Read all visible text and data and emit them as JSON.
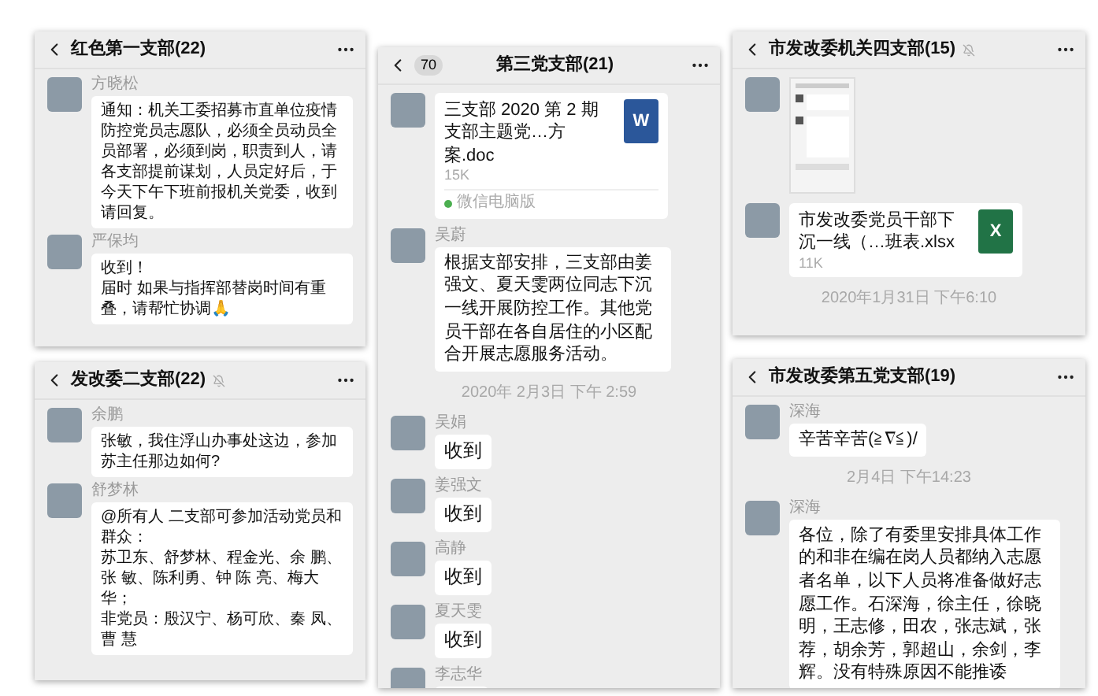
{
  "columns": [
    {
      "panels": [
        {
          "title": "红色第一支部(22)",
          "muted": false,
          "messages": [
            {
              "kind": "text",
              "sender": "方晓松",
              "text": "通知：机关工委招募市直单位疫情防控党员志愿队，必须全员动员全员部署，必须到岗，职责到人，请各支部提前谋划，人员定好后，于今天下午下班前报机关党委，收到请回复。"
            },
            {
              "kind": "text",
              "sender": "严保均",
              "lines": [
                "收到！",
                "届时 如果与指挥部替岗时间有重叠，请帮忙协调🙏"
              ]
            }
          ]
        },
        {
          "title": "发改委二支部(22)",
          "muted": true,
          "messages": [
            {
              "kind": "text",
              "sender": "余鹏",
              "text": "张敏，我住浮山办事处这边，参加苏主任那边如何?"
            },
            {
              "kind": "text",
              "sender": "舒梦林",
              "lines": [
                "@所有人 二支部可参加活动党员和群众：",
                "苏卫东、舒梦林、程金光、余 鹏、张 敏、陈利勇、钟 陈 亮、梅大华；",
                "非党员：殷汉宁、杨可欣、秦 凤、曹 慧"
              ]
            }
          ]
        }
      ]
    },
    {
      "panels": [
        {
          "title": "第三党支部(21)",
          "badge": "70",
          "muted": false,
          "messages": [
            {
              "kind": "file",
              "filename": "三支部 2020 第 2 期支部主题党…方案.doc",
              "size": "15K",
              "letter": "W",
              "color": "#2b579a",
              "source": "微信电脑版"
            },
            {
              "kind": "text",
              "sender": "吴蔚",
              "text": "根据支部安排，三支部由姜强文、夏天雯两位同志下沉一线开展防控工作。其他党员干部在各自居住的小区配合开展志愿服务活动。"
            },
            {
              "kind": "time",
              "text": "2020年 2月3日 下午 2:59"
            },
            {
              "kind": "text",
              "sender": "吴娟",
              "text": "收到"
            },
            {
              "kind": "text",
              "sender": "姜强文",
              "text": "收到"
            },
            {
              "kind": "text",
              "sender": "高静",
              "text": "收到"
            },
            {
              "kind": "text",
              "sender": "夏天雯",
              "text": "收到"
            },
            {
              "kind": "text",
              "sender": "李志华"
            }
          ]
        }
      ]
    },
    {
      "panels": [
        {
          "title": "市发改委机关四支部(15)",
          "muted": true,
          "messages": [
            {
              "kind": "image"
            },
            {
              "kind": "file",
              "filename": "市发改委党员干部下沉一线（…班表.xlsx",
              "size": "11K",
              "letter": "X",
              "color": "#217346"
            },
            {
              "kind": "time",
              "text": "2020年1月31日 下午6:10"
            }
          ]
        },
        {
          "title": "市发改委第五党支部(19)",
          "muted": false,
          "messages": [
            {
              "kind": "text",
              "sender": "深海",
              "text": "辛苦辛苦(≧∇≦)/"
            },
            {
              "kind": "time",
              "text": "2月4日 下午14:23"
            },
            {
              "kind": "text",
              "sender": "深海",
              "text": "各位，除了有委里安排具体工作的和非在编在岗人员都纳入志愿者名单，以下人员将准备做好志愿工作。石深海，徐主任，徐晓明，王志修，田农，张志斌，张荐，胡余芳，郭超山，余剑，李辉。没有特殊原因不能推诿"
            }
          ]
        }
      ]
    }
  ]
}
